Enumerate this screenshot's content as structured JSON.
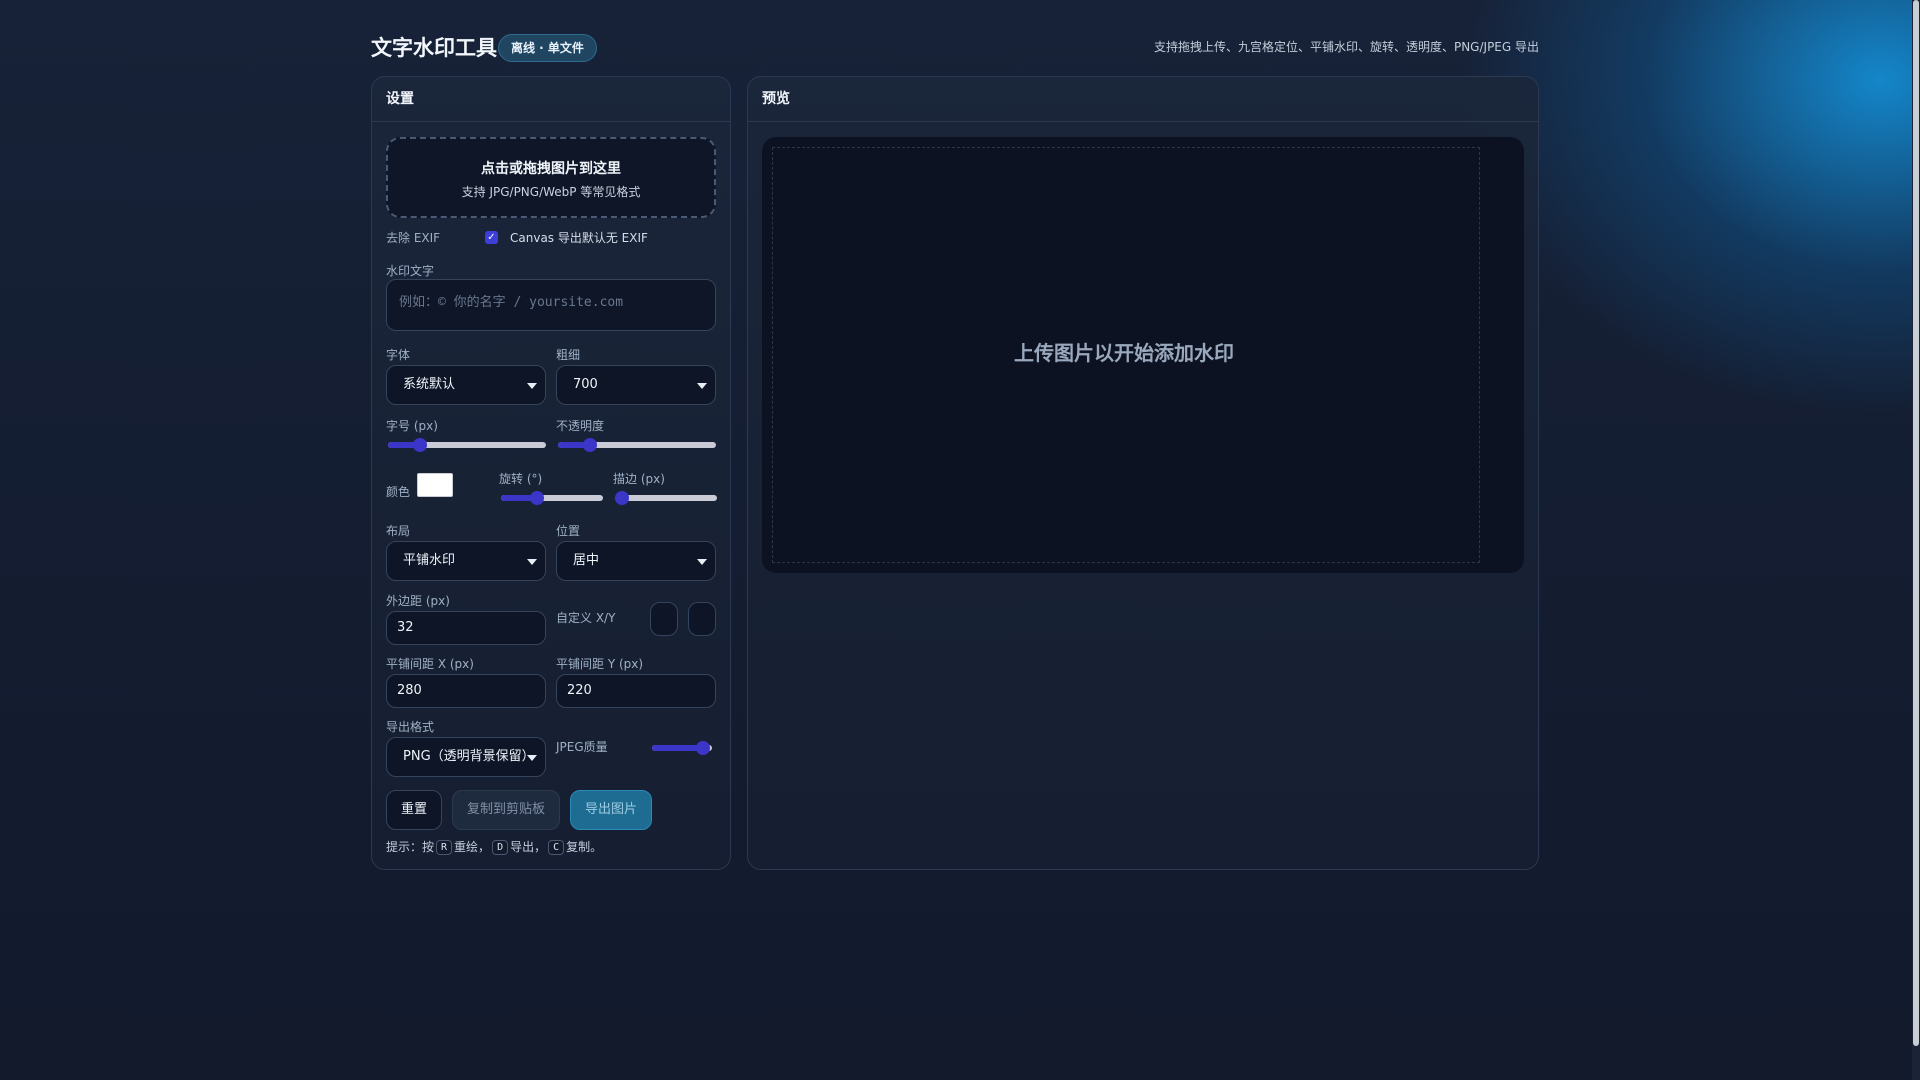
{
  "header": {
    "title": "文字水印工具",
    "badge": "离线 · 单文件",
    "description": "支持拖拽上传、九宫格定位、平铺水印、旋转、透明度、PNG/JPEG 导出"
  },
  "settings": {
    "heading": "设置",
    "dropzone": {
      "title": "点击或拖拽图片到这里",
      "subtitle": "支持 JPG/PNG/WebP 等常见格式"
    },
    "exif": {
      "label": "去除 EXIF",
      "checked": true,
      "text": "Canvas 导出默认无 EXIF"
    },
    "watermark_text": {
      "label": "水印文字",
      "value": "",
      "placeholder": "例如：© 你的名字 / yoursite.com"
    },
    "font": {
      "label": "字体",
      "value": "系统默认"
    },
    "weight": {
      "label": "粗细",
      "value": "700"
    },
    "font_size": {
      "label": "字号 (px)",
      "level": 0.2
    },
    "opacity": {
      "label": "不透明度",
      "level": 0.2
    },
    "color": {
      "label": "颜色",
      "value": "#ffffff"
    },
    "rotation": {
      "label": "旋转 (°)",
      "level": 0.35
    },
    "stroke": {
      "label": "描边 (px)",
      "level": 0.0
    },
    "layout": {
      "label": "布局",
      "value": "平铺水印"
    },
    "position": {
      "label": "位置",
      "value": "居中"
    },
    "margin": {
      "label": "外边距 (px)",
      "value": "32"
    },
    "custom_xy": {
      "label": "自定义 X/Y"
    },
    "tile_gap_x": {
      "label": "平铺间距 X (px)",
      "value": "280"
    },
    "tile_gap_y": {
      "label": "平铺间距 Y (px)",
      "value": "220"
    },
    "export_format": {
      "label": "导出格式",
      "value": "PNG（透明背景保留）"
    },
    "jpeg_quality": {
      "label": "JPEG质量",
      "level": 0.85
    },
    "buttons": {
      "reset": "重置",
      "copy": "复制到剪贴板",
      "export": "导出图片"
    },
    "hint": {
      "prefix": "提示：按",
      "key_r": "R",
      "redraw": "重绘，",
      "key_d": "D",
      "export": "导出，",
      "key_c": "C",
      "copy": "复制。"
    }
  },
  "preview": {
    "heading": "预览",
    "empty_message": "上传图片以开始添加水印"
  },
  "colors": {
    "accent": "#3b35c8",
    "export_button": "#1e6c91",
    "background": "#141d31"
  }
}
